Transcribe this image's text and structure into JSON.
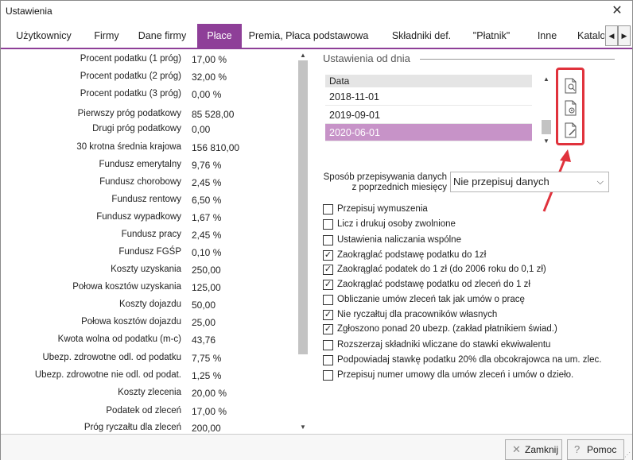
{
  "window": {
    "title": "Ustawienia",
    "close_glyph": "✕"
  },
  "tabs": [
    {
      "label": "Użytkownicy"
    },
    {
      "label": "Firmy"
    },
    {
      "label": "Dane firmy"
    },
    {
      "label": "Płace",
      "active": true
    },
    {
      "label": "Premia, Płaca podstawowa"
    },
    {
      "label": "Składniki def."
    },
    {
      "label": "\"Płatnik\""
    },
    {
      "label": "Inne"
    },
    {
      "label": "Katalo"
    }
  ],
  "params": [
    {
      "label": "Procent podatku (1 próg)",
      "value": "17,00 %"
    },
    {
      "label": "Procent podatku (2 próg)",
      "value": "32,00 %"
    },
    {
      "label": "Procent podatku (3 próg)",
      "value": "0,00 %"
    },
    {
      "label": "Pierwszy próg podatkowy",
      "value": "85 528,00"
    },
    {
      "label": "Drugi próg podatkowy",
      "value": "0,00"
    },
    {
      "label": "30 krotna średnia krajowa",
      "value": "156 810,00"
    },
    {
      "label": "Fundusz emerytalny",
      "value": "9,76 %"
    },
    {
      "label": "Fundusz chorobowy",
      "value": "2,45 %"
    },
    {
      "label": "Fundusz rentowy",
      "value": "6,50 %"
    },
    {
      "label": "Fundusz wypadkowy",
      "value": "1,67 %"
    },
    {
      "label": "Fundusz pracy",
      "value": "2,45 %"
    },
    {
      "label": "Fundusz FGŚP",
      "value": "0,10 %"
    },
    {
      "label": "Koszty uzyskania",
      "value": "250,00"
    },
    {
      "label": "Połowa kosztów uzyskania",
      "value": "125,00"
    },
    {
      "label": "Koszty dojazdu",
      "value": "50,00"
    },
    {
      "label": "Połowa kosztów dojazdu",
      "value": "25,00"
    },
    {
      "label": "Kwota wolna od podatku (m-c)",
      "value": "43,76"
    },
    {
      "label": "Ubezp. zdrowotne odl. od podatku",
      "value": "7,75 %"
    },
    {
      "label": "Ubezp. zdrowotne nie odl. od podat.",
      "value": "1,25 %"
    },
    {
      "label": "Koszty zlecenia",
      "value": "20,00 %"
    },
    {
      "label": "Podatek od zleceń",
      "value": "17,00 %"
    },
    {
      "label": "Próg ryczałtu dla zleceń",
      "value": "200,00"
    }
  ],
  "settings": {
    "section_title": "Ustawienia od dnia",
    "list_header": "Data",
    "dates": [
      "2018-11-01",
      "2019-09-01",
      "2020-06-01"
    ],
    "selected_index": 2
  },
  "icons": [
    "document-search-icon",
    "document-settings-icon",
    "document-edit-icon"
  ],
  "combo": {
    "label": "Sposób przepisywania danych z poprzednich miesięcy",
    "value": "Nie przepisuj danych"
  },
  "checkboxes": [
    {
      "label": "Przepisuj wymuszenia",
      "checked": false
    },
    {
      "label": "Licz i drukuj osoby zwolnione",
      "checked": false
    },
    {
      "label": "Ustawienia naliczania wspólne",
      "checked": false
    },
    {
      "label": "Zaokrąglać podstawę podatku do 1zł",
      "checked": true
    },
    {
      "label": "Zaokrąglać podatek do 1 zł (do 2006 roku do 0,1 zł)",
      "checked": true
    },
    {
      "label": "Zaokrąglać podstawę podatku od zleceń do 1 zł",
      "checked": true
    },
    {
      "label": "Obliczanie umów zleceń tak jak umów o pracę",
      "checked": false
    },
    {
      "label": "Nie ryczałtuj dla pracowników własnych",
      "checked": true
    },
    {
      "label": "Zgłoszono ponad 20 ubezp. (zakład płatnikiem świad.)",
      "checked": true
    },
    {
      "label": "Rozszerzaj składniki wliczane do stawki ekwiwalentu",
      "checked": false
    },
    {
      "label": "Podpowiadaj stawkę podatku 20% dla obcokrajowca na um. zlec.",
      "checked": false
    },
    {
      "label": "Przepisuj numer umowy dla umów zleceń i umów o dzieło.",
      "checked": false
    }
  ],
  "buttons": {
    "close_label": "Zamknij",
    "help_label": "Pomoc"
  },
  "colors": {
    "accent": "#8e3f98",
    "selection": "#c793c8",
    "highlight": "#e0323c"
  }
}
